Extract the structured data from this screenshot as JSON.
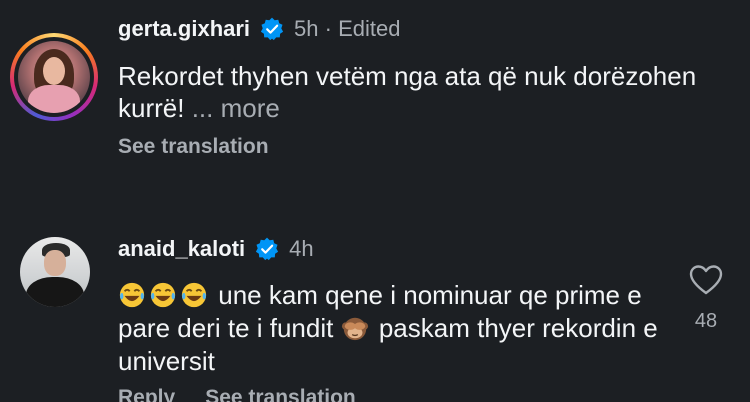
{
  "comments": [
    {
      "username": "gerta.gixhari",
      "verified": true,
      "time": "5h",
      "separator": "·",
      "edited_label": "Edited",
      "text": "Rekordet thyhen vetëm nga ata që nuk dorëzohen kurrë!",
      "ellipsis": "...",
      "more_label": "more",
      "see_translation": "See translation",
      "avatar_icon": "profile-photo-icon",
      "story_ring": true
    },
    {
      "username": "anaid_kaloti",
      "verified": true,
      "time": "4h",
      "text_part1": "une kam qene i nominuar qe prime e pare deri te i fundit",
      "text_part2": "paskam thyer rekordin e universit",
      "leading_emojis": [
        "laughing-crying-emoji",
        "laughing-crying-emoji",
        "laughing-crying-emoji"
      ],
      "inline_emoji": "see-no-evil-monkey-emoji",
      "reply_label": "Reply",
      "see_translation": "See translation",
      "like_count": "48",
      "avatar_icon": "profile-photo-icon"
    }
  ],
  "colors": {
    "background": "#1c1f23",
    "primary_text": "#f3f5f7",
    "secondary_text": "#a8adb3",
    "verified_blue": "#0095f6"
  }
}
